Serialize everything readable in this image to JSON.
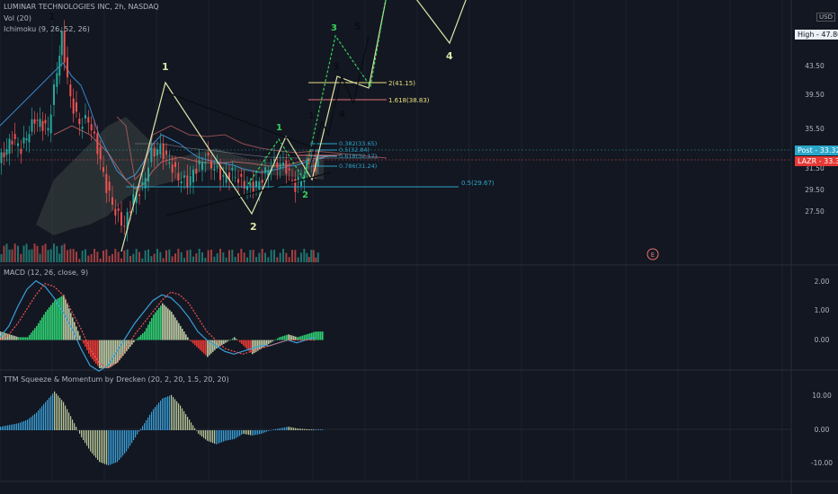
{
  "header": {
    "title": "LUMINAR TECHNOLOGIES INC, 2h, NASDAQ",
    "vol_label": "Vol (20)",
    "ichimoku_label": "Ichimoku (9, 26, 52, 26)",
    "currency": "USD"
  },
  "colors": {
    "background": "#131722",
    "up": "#26a69a",
    "down": "#ef5350",
    "macd_pos": "#2ecc71",
    "macd_neg": "#e53935",
    "macd_fade": "#b8c7a0",
    "ttm_blue": "#3aa0d9",
    "ttm_pale": "#b9c99a",
    "wave_pale": "#dfe6a6",
    "wave_green": "#35d05a",
    "black": "#0b0d12",
    "fib_cyan": "#2aa6c8",
    "fib_yellow": "#e8e07a",
    "ichimoku_red": "#e57373",
    "ichimoku_blue": "#42a5f5"
  },
  "price_axis": {
    "ticks": [
      "43.50",
      "39.50",
      "35.50",
      "31.50",
      "29.50",
      "27.50"
    ],
    "high_badge": "High - 47.80",
    "post_badge": "Post - 33.32",
    "lazr_badge": "LAZR - 33.37"
  },
  "macd": {
    "label": "MACD (12, 26, close, 9)",
    "ticks": [
      "2.00",
      "1.00",
      "0.00"
    ]
  },
  "ttm": {
    "label": "TTM Squeeze & Momentum by Drecken (20, 2, 20, 1.5, 20, 20)",
    "ticks": [
      "10.00",
      "0.00",
      "-10.00"
    ]
  },
  "wave_labels": {
    "w1_top": "1",
    "w1_pale": "1",
    "w2_pale": "2",
    "w1_green": "1",
    "w2_green": "2",
    "w1_dark": "1",
    "w3_dark": "3",
    "w4_dark": "4",
    "w5_dark": "5",
    "w3_green": "3",
    "w4_pale": "4"
  },
  "fib_labels": {
    "ext2": "2(41.15)",
    "ext1618": "1.618(38.83)",
    "r382": "0.382(33.65)",
    "r50": "0.5(32.84)",
    "r618": "0.618(32.17)",
    "r786": "0.786(31.24)",
    "r05b": "0.5(29.67)"
  },
  "earnings_marker": "E",
  "chart_data": {
    "type": "line",
    "title": "LUMINAR TECHNOLOGIES INC, 2h, NASDAQ",
    "xlabel": "",
    "ylabel": "",
    "ylim": [
      23.5,
      49.5
    ],
    "price_ticks": [
      43.5,
      39.5,
      35.5,
      31.5,
      29.5,
      27.5
    ],
    "series": [
      {
        "name": "LAZR",
        "x": [
          0,
          15,
          25,
          40,
          55,
          65,
          70,
          80,
          90,
          100,
          110,
          120,
          130,
          140,
          150,
          160,
          170,
          180,
          190,
          200,
          210,
          220,
          230,
          240,
          250,
          260,
          270,
          280,
          290,
          300,
          310,
          320,
          330,
          340,
          345,
          350,
          355
        ],
        "values": [
          33.5,
          36.0,
          35.0,
          38.0,
          37.0,
          43.0,
          46.5,
          40.0,
          37.5,
          38.0,
          35.0,
          31.0,
          28.5,
          27.0,
          30.0,
          31.0,
          34.5,
          35.0,
          33.5,
          32.0,
          31.5,
          33.0,
          34.0,
          33.0,
          32.0,
          32.5,
          31.5,
          31.0,
          31.5,
          33.0,
          33.5,
          33.0,
          31.0,
          32.5,
          34.0,
          33.0,
          33.37
        ]
      }
    ],
    "annotations": {
      "high": 47.8,
      "post": 33.32,
      "last": 33.37,
      "fib_levels": [
        41.15,
        38.83,
        33.65,
        32.84,
        32.17,
        31.24,
        29.67
      ]
    },
    "macd": {
      "ylim": [
        -1.0,
        2.5
      ],
      "hist_x": [
        0,
        10,
        20,
        30,
        40,
        50,
        60,
        70,
        80,
        90,
        100,
        110,
        120,
        130,
        140,
        150,
        160,
        170,
        180,
        190,
        200,
        210,
        220,
        230,
        240,
        250,
        260,
        270,
        280,
        290,
        300,
        310,
        320,
        330,
        340,
        350
      ],
      "hist": [
        0.3,
        0.2,
        0.1,
        0.1,
        0.5,
        1.0,
        1.4,
        1.6,
        0.8,
        0.0,
        -0.6,
        -1.0,
        -1.0,
        -0.8,
        -0.4,
        0.0,
        0.3,
        0.9,
        1.3,
        1.0,
        0.5,
        0.0,
        -0.3,
        -0.6,
        -0.3,
        -0.1,
        0.1,
        -0.2,
        -0.5,
        -0.3,
        -0.1,
        0.1,
        0.2,
        0.1,
        0.2,
        0.3
      ],
      "macd_line": [
        0.1,
        0.5,
        1.2,
        1.8,
        2.1,
        1.9,
        1.5,
        1.0,
        0.4,
        -0.3,
        -0.9,
        -1.1,
        -0.9,
        -0.4,
        0.1,
        0.6,
        1.0,
        1.4,
        1.6,
        1.5,
        1.2,
        0.8,
        0.3,
        0.0,
        -0.2,
        -0.4,
        -0.5,
        -0.4,
        -0.3,
        -0.2,
        -0.2,
        -0.1,
        0.0,
        -0.1,
        0.0,
        0.1
      ],
      "signal_line": [
        0.0,
        0.2,
        0.6,
        1.1,
        1.6,
        2.0,
        1.9,
        1.6,
        1.0,
        0.4,
        -0.3,
        -0.8,
        -1.0,
        -0.8,
        -0.3,
        0.2,
        0.6,
        1.0,
        1.4,
        1.7,
        1.6,
        1.3,
        0.8,
        0.3,
        0.0,
        -0.3,
        -0.4,
        -0.5,
        -0.4,
        -0.3,
        -0.2,
        -0.1,
        0.0,
        0.0,
        0.0,
        0.0
      ]
    },
    "ttm_momentum": {
      "ylim": [
        -13,
        13
      ],
      "x": [
        0,
        10,
        20,
        30,
        40,
        50,
        60,
        70,
        80,
        90,
        100,
        110,
        120,
        130,
        140,
        150,
        160,
        170,
        180,
        190,
        200,
        210,
        220,
        230,
        240,
        250,
        260,
        270,
        280,
        290,
        300,
        310,
        320,
        330,
        340,
        350
      ],
      "values": [
        1.0,
        1.5,
        2.0,
        3.0,
        5.0,
        8.0,
        11.0,
        8.0,
        3.0,
        -2.0,
        -6.0,
        -9.0,
        -10.0,
        -9.0,
        -6.0,
        -2.0,
        2.0,
        6.0,
        9.0,
        10.0,
        7.0,
        3.0,
        -1.0,
        -3.0,
        -4.0,
        -3.0,
        -2.5,
        -1.0,
        -1.5,
        -1.0,
        0.0,
        0.5,
        1.0,
        0.5,
        0.3,
        0.2
      ]
    }
  }
}
